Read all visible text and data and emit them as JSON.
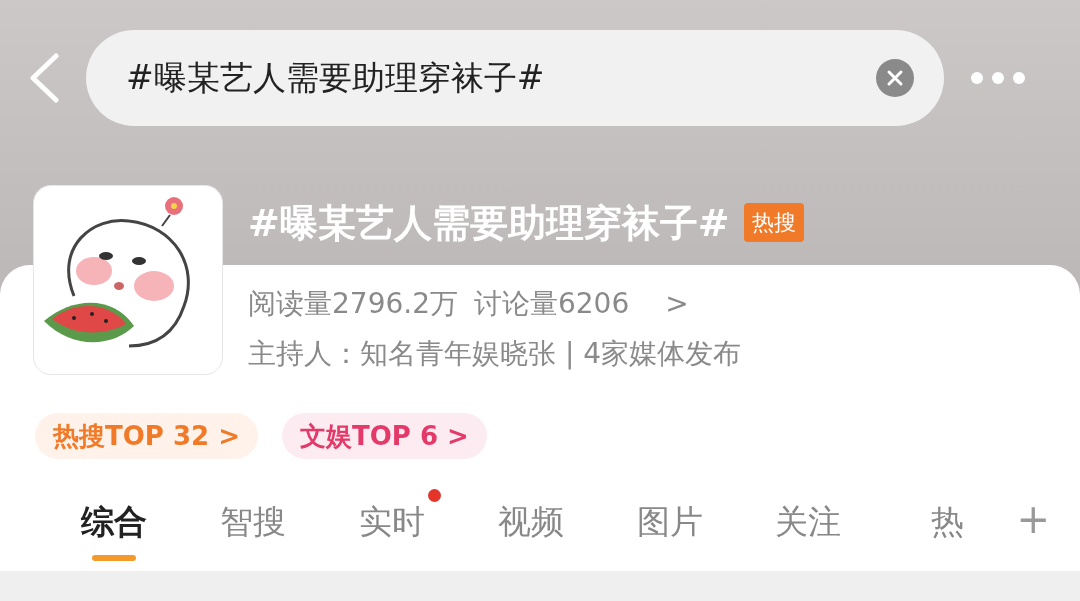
{
  "search": {
    "value": "#曝某艺人需要助理穿袜子#"
  },
  "topic": {
    "title": "#曝某艺人需要助理穿袜子#",
    "badge": "热搜",
    "stats": [
      "阅读量2796.2万",
      "讨论量6206"
    ],
    "arrow": ">",
    "host": "主持人：知名青年娱晓张 | 4家媒体发布"
  },
  "chips": [
    {
      "label": "热搜TOP 32",
      "arrow": ">",
      "color": "#f07a28"
    },
    {
      "label": "文娱TOP 6",
      "arrow": ">",
      "color": "#e33a6a"
    }
  ],
  "tabs": [
    {
      "label": "综合",
      "selected": true,
      "dot": false
    },
    {
      "label": "智搜",
      "selected": false,
      "dot": false
    },
    {
      "label": "实时",
      "selected": false,
      "dot": true
    },
    {
      "label": "视频",
      "selected": false,
      "dot": false
    },
    {
      "label": "图片",
      "selected": false,
      "dot": false
    },
    {
      "label": "关注",
      "selected": false,
      "dot": false
    },
    {
      "label": "热",
      "selected": false,
      "dot": false
    }
  ],
  "add_tab": "+"
}
